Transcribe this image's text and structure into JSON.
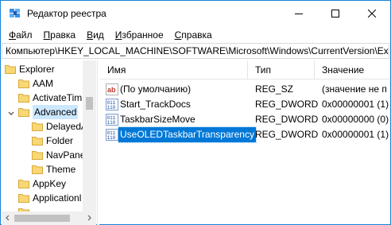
{
  "window": {
    "title": "Редактор реестра",
    "accent": "#1883d7"
  },
  "menu": [
    "Файл",
    "Правка",
    "Вид",
    "Избранное",
    "Справка"
  ],
  "menu_underline": [
    "Ф",
    "П",
    "В",
    "И",
    "С"
  ],
  "menu_rest": [
    "айл",
    "равка",
    "ид",
    "збранное",
    "правка"
  ],
  "address": "Компьютер\\HKEY_LOCAL_MACHINE\\SOFTWARE\\Microsoft\\Windows\\CurrentVersion\\Ex",
  "tree": [
    {
      "label": "Explorer",
      "expanded": true
    },
    {
      "label": "AAM"
    },
    {
      "label": "ActivateTim"
    },
    {
      "label": "Advanced",
      "selected": true,
      "expanded": true
    },
    {
      "label": "DelayedA"
    },
    {
      "label": "Folder"
    },
    {
      "label": "NavPane"
    },
    {
      "label": "Theme"
    },
    {
      "label": "AppKey"
    },
    {
      "label": "Applicationl"
    },
    {
      "label": ""
    }
  ],
  "columns": {
    "name": "Имя",
    "type": "Тип",
    "data": "Значение"
  },
  "values": [
    {
      "name": "(По умолчанию)",
      "type": "REG_SZ",
      "data": "(значение не п",
      "icon": "string-value-icon"
    },
    {
      "name": "Start_TrackDocs",
      "type": "REG_DWORD",
      "data": "0x00000001 (1)",
      "icon": "dword-value-icon"
    },
    {
      "name": "TaskbarSizeMove",
      "type": "REG_DWORD",
      "data": "0x00000000 (0)",
      "icon": "dword-value-icon"
    },
    {
      "name": "UseOLEDTaskbarTransparency",
      "type": "REG_DWORD",
      "data": "0x00000001 (1)",
      "icon": "dword-value-icon",
      "selected": true
    }
  ]
}
